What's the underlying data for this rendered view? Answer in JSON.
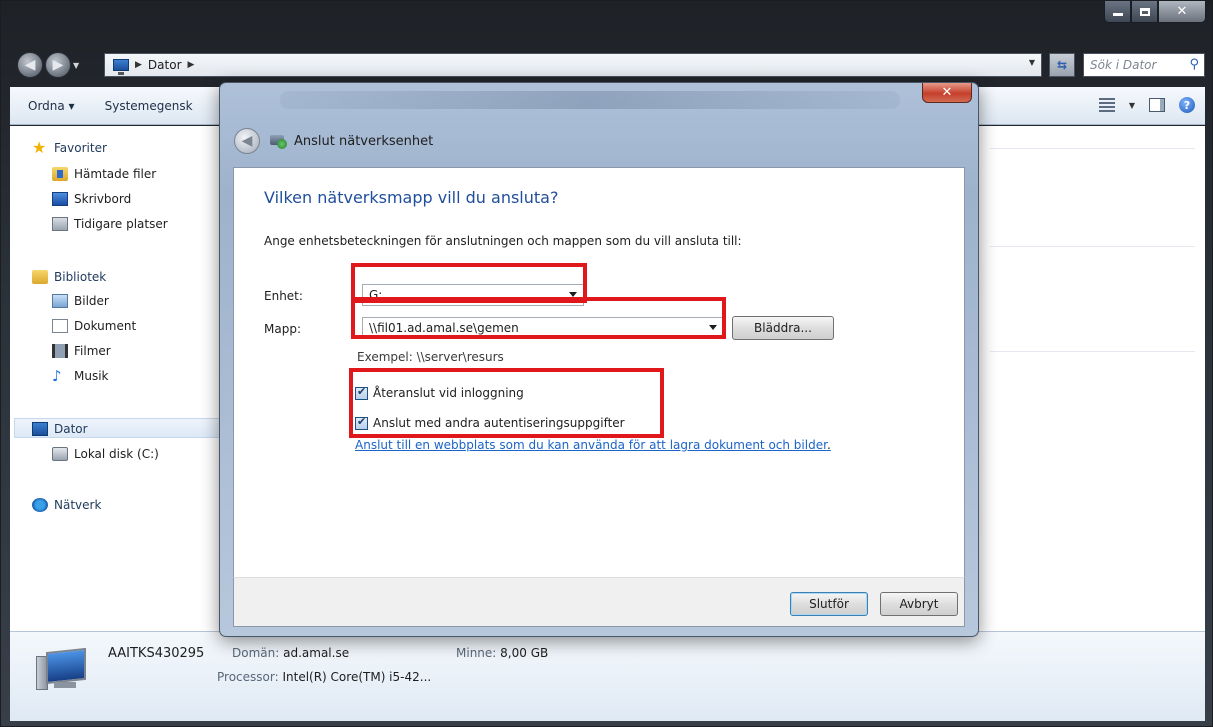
{
  "explorer": {
    "breadcrumb": "Dator",
    "search_placeholder": "Sök i Dator",
    "toolbar": {
      "organize": "Ordna ▾",
      "system": "Systemegensk"
    },
    "nav": {
      "favorites": "Favoriter",
      "downloads": "Hämtade filer",
      "desktop": "Skrivbord",
      "recent": "Tidigare platser",
      "libraries": "Bibliotek",
      "pictures": "Bilder",
      "documents": "Dokument",
      "videos": "Filmer",
      "music": "Musik",
      "computer": "Dator",
      "local_disk": "Lokal disk (C:)",
      "network": "Nätverk"
    },
    "details": {
      "computer_name": "AAITKS430295",
      "domain_label": "Domän:",
      "domain_value": "ad.amal.se",
      "memory_label": "Minne:",
      "memory_value": "8,00 GB",
      "processor_label": "Processor:",
      "processor_value": "Intel(R) Core(TM) i5-42..."
    }
  },
  "dialog": {
    "title": "Anslut nätverksenhet",
    "instruction": "Vilken nätverksmapp vill du ansluta?",
    "subtext": "Ange enhetsbeteckningen för anslutningen och mappen som du vill ansluta till:",
    "drive_label": "Enhet:",
    "drive_value": "G:",
    "folder_label": "Mapp:",
    "folder_value": "\\\\fil01.ad.amal.se\\gemen",
    "browse_button": "Bläddra...",
    "example": "Exempel: \\\\server\\resurs",
    "reconnect_label": "Återanslut vid inloggning",
    "reconnect_checked": true,
    "credentials_label": "Anslut med andra autentiseringsuppgifter",
    "credentials_checked": true,
    "link": "Anslut till en webbplats som du kan använda för att lagra dokument och bilder",
    "link_suffix": ".",
    "finish_button": "Slutför",
    "cancel_button": "Avbryt"
  },
  "colors": {
    "instruction": "#1f4e9c",
    "link": "#1a64c8",
    "highlight": "#e0181b"
  }
}
